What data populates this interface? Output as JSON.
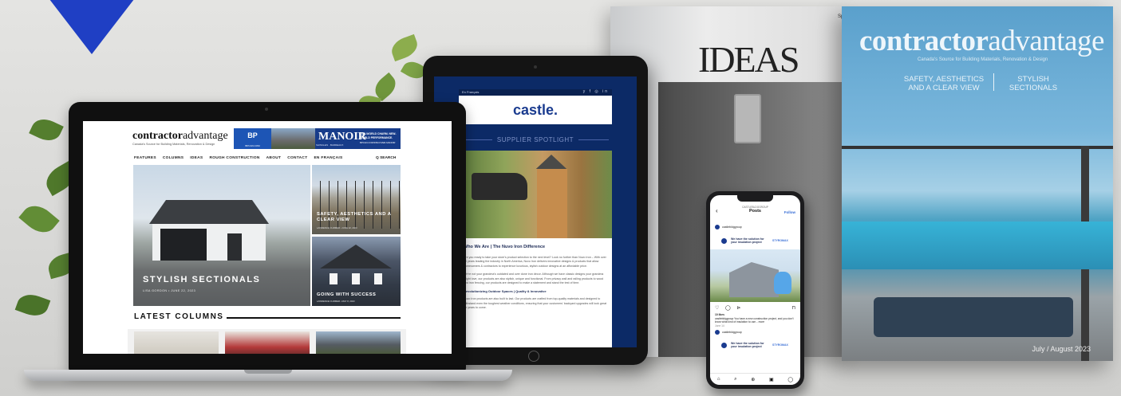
{
  "magazine_back": {
    "title": "IDEAS",
    "spine_fragment": "Sp"
  },
  "magazine_front": {
    "masthead_bold": "contractor",
    "masthead_light": "advantage",
    "tagline": "Canada's Source for Building Materials, Renovation & Design",
    "cover_line_1": "SAFETY, AESTHETICS AND A CLEAR VIEW",
    "cover_line_2": "STYLISH SECTIONALS",
    "issue": "July / August 2023"
  },
  "tablet": {
    "lang": "En Français",
    "social_icons": "y f ◎ in",
    "logo": "castle.",
    "section": "SUPPLIER SPOTLIGHT",
    "article_title": "Who We Are | The Nuvo Iron Difference",
    "para_1": "Are you ready to take your store's product selection to the next level? Look no further than Nuvo Iron – With over 20 years leading the industry in North America, Nuvo Iron delivers innovative designs & products that allow homeowners & contractors to experience luxurious, stylish outdoor designs at an affordable price.",
    "para_2": "We're not your grandma's outdated and over done iron decor. Although we have classic designs your grandma might love, our products are also stylish, unique and functional. From privacy wall and railing products to wood and iron fencing, our products are designed to make a statement and stand the test of time.",
    "subhead": "Revolutionizing Outdoor Spaces | Quality & Innovative",
    "para_3": "Nuvo Iron products are also built to last. Our products are crafted from top-quality materials and designed to withstand even the toughest weather conditions, ensuring that your customers' backyard upgrades will look great for years to come."
  },
  "laptop": {
    "brand_bold": "contractor",
    "brand_light": "advantage",
    "brand_sub": "Canada's Source for Building Materials, Renovation & Design",
    "ad": {
      "bp": "BP",
      "bp_url": "BPCAN.COM",
      "manoir": "MANOIR",
      "manoir_sub": "SHINGLES · BARDEAUX",
      "headline": "OLD-WORLD CHARM. NEW-WORLD PERFORMANCE.",
      "url": "BPCAN.COM/DISCOVER-MANOIR"
    },
    "nav": [
      "FEATURES",
      "COLUMNS",
      "IDEAS",
      "ROUGH CONSTRUCTION",
      "ABOUT",
      "CONTACT",
      "EN FRANÇAIS"
    ],
    "search": "Q SEARCH",
    "hero_title": "STYLISH SECTIONALS",
    "hero_byline": "LISA GORDON • JUNE 22, 2023",
    "side_1_title": "SAFETY, AESTHETICS AND A CLEAR VIEW",
    "side_1_byline": "LAWRENCE CUMMER • JUNE 22, 2023",
    "side_2_title": "GOING WITH SUCCESS",
    "side_2_byline": "LAWRENCE CUMMER • MAY 8, 2023",
    "latest": "LATEST COLUMNS"
  },
  "phone": {
    "account": "CASTLEBLDGGROUP",
    "title": "Posts",
    "follow": "Follow",
    "back": "‹",
    "handle": "castlebldggroup",
    "ad_headline": "We have the solution for your insulation project",
    "ad_logo": "STYROMAX",
    "icons": "♡ ◯ ⊳",
    "save": "⊓",
    "likes": "10 likes",
    "caption": "castlebldggroup You have a new construction project, and you don't know what kind of insulation to use... more",
    "date": "June 14",
    "handle_2": "castlebldggroup",
    "ad_headline_2": "We have the solution for your insulation project",
    "tabbar": [
      "⌂",
      "⌕",
      "⊕",
      "▣",
      "◯"
    ]
  }
}
